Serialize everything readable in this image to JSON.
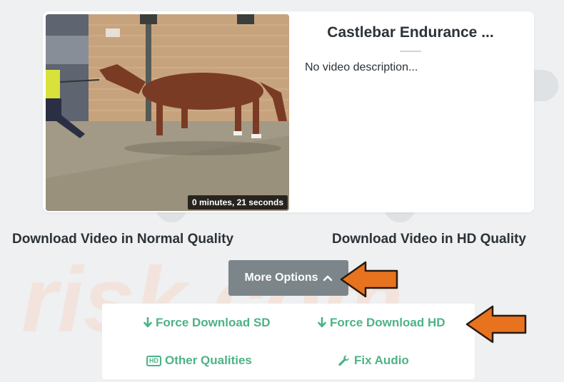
{
  "video": {
    "title": "Castlebar Endurance ...",
    "description": "No video description...",
    "duration": "0 minutes, 21 seconds"
  },
  "downloads": {
    "normal_label": "Download Video in Normal Quality",
    "hd_label": "Download Video in HD Quality"
  },
  "more_options": {
    "label": "More Options"
  },
  "options": {
    "force_sd": "Force Download SD",
    "force_hd": "Force Download HD",
    "other_qualities": "Other Qualities",
    "fix_audio": "Fix Audio",
    "hd_badge": "HD"
  },
  "watermark": {
    "text": "risk.com"
  },
  "colors": {
    "accent_green": "#4cb386",
    "button_gray": "#7b858a",
    "annotation_orange": "#e8731e",
    "text_dark": "#2b3238"
  },
  "icons": {
    "force_sd": "arrow-down-icon",
    "force_hd": "arrow-down-icon",
    "other_qualities": "hd-icon",
    "fix_audio": "wrench-icon",
    "more_options": "chevron-up-icon"
  }
}
